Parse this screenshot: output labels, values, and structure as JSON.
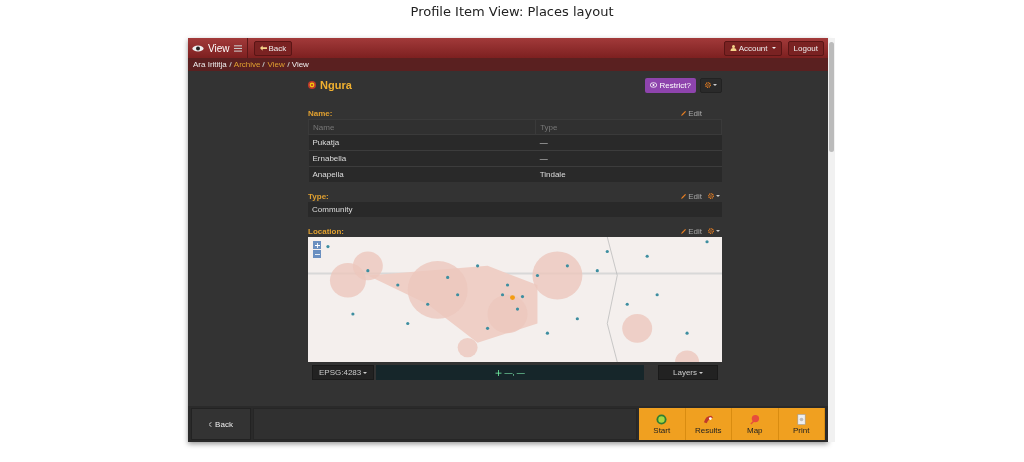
{
  "caption": "Profile Item View: Places layout",
  "navbar": {
    "title": "View",
    "back": "Back",
    "account": "Account",
    "logout": "Logout"
  },
  "breadcrumbs": [
    {
      "label": "Ara Irititja",
      "link": false
    },
    {
      "label": "Archive",
      "link": true
    },
    {
      "label": "View",
      "link": true
    },
    {
      "label": "View",
      "link": false
    }
  ],
  "item": {
    "title": "Ngura",
    "restrict": "Restrict?"
  },
  "sections": [
    {
      "kind": "table",
      "label": "Name:",
      "edit": "Edit",
      "gear": false,
      "columns": [
        "Name",
        "Type"
      ],
      "rows": [
        [
          "Pukatja",
          "—"
        ],
        [
          "Ernabella",
          "—"
        ],
        [
          "Anapella",
          "Tindale"
        ]
      ]
    },
    {
      "kind": "text",
      "label": "Type:",
      "edit": "Edit",
      "gear": true,
      "value": "Community"
    },
    {
      "kind": "map",
      "label": "Location:",
      "edit": "Edit",
      "gear": true,
      "projection": "EPSG:4283",
      "coordinates": "—, —",
      "layers": "Layers"
    }
  ],
  "footer": {
    "back": "Back",
    "tabs": [
      {
        "label": "Start"
      },
      {
        "label": "Results"
      },
      {
        "label": "Map"
      },
      {
        "label": "Print"
      }
    ]
  }
}
